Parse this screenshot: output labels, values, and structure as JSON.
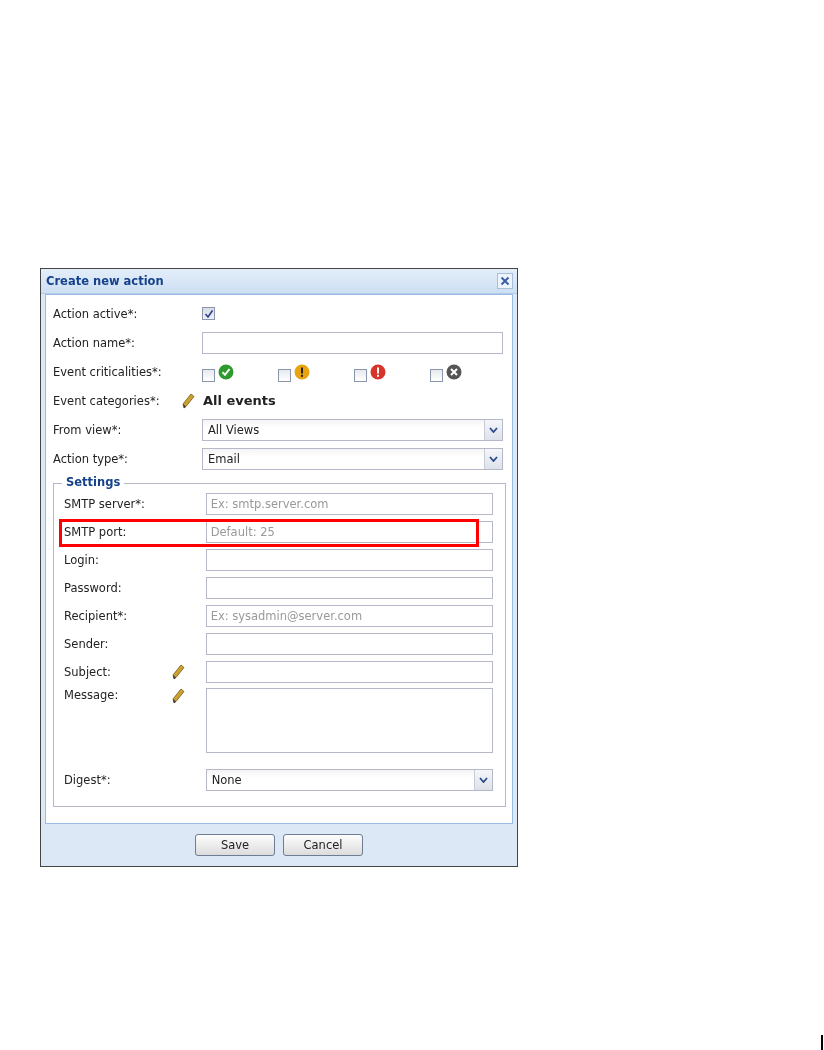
{
  "dialog": {
    "title": "Create new action"
  },
  "fields": [
    {
      "kind": "checkbox",
      "label": "Action active*:",
      "checked": true
    },
    {
      "kind": "text",
      "label": "Action name*:"
    },
    {
      "kind": "criticalities",
      "label": "Event criticalities*:",
      "options": [
        {
          "kind": "ok",
          "checked": false
        },
        {
          "kind": "warning",
          "checked": false
        },
        {
          "kind": "error",
          "checked": false
        },
        {
          "kind": "unknown",
          "checked": false
        }
      ]
    },
    {
      "kind": "link",
      "label": "Event categories*:",
      "value": "All events"
    },
    {
      "kind": "select",
      "label": "From view*:",
      "value": "All Views"
    },
    {
      "kind": "select",
      "label": "Action type*:",
      "value": "Email"
    }
  ],
  "settings": {
    "legend": "Settings",
    "fields": [
      {
        "kind": "text",
        "label": "SMTP server*:",
        "placeholder": "Ex: smtp.server.com",
        "highlighted": false
      },
      {
        "kind": "text",
        "label": "SMTP port:",
        "placeholder": "Default: 25",
        "highlighted": true
      },
      {
        "kind": "text",
        "label": "Login:",
        "highlighted": false
      },
      {
        "kind": "text",
        "label": "Password:",
        "highlighted": false
      },
      {
        "kind": "text",
        "label": "Recipient*:",
        "placeholder": "Ex: sysadmin@server.com",
        "highlighted": false
      },
      {
        "kind": "text",
        "label": "Sender:",
        "highlighted": false
      },
      {
        "kind": "rich-text",
        "label": "Subject:",
        "highlighted": false
      },
      {
        "kind": "textarea",
        "label": "Message:",
        "highlighted": false
      },
      {
        "kind": "select",
        "label": "Digest*:",
        "value": "None",
        "highlighted": false
      }
    ]
  },
  "buttons": [
    "Save",
    "Cancel"
  ]
}
